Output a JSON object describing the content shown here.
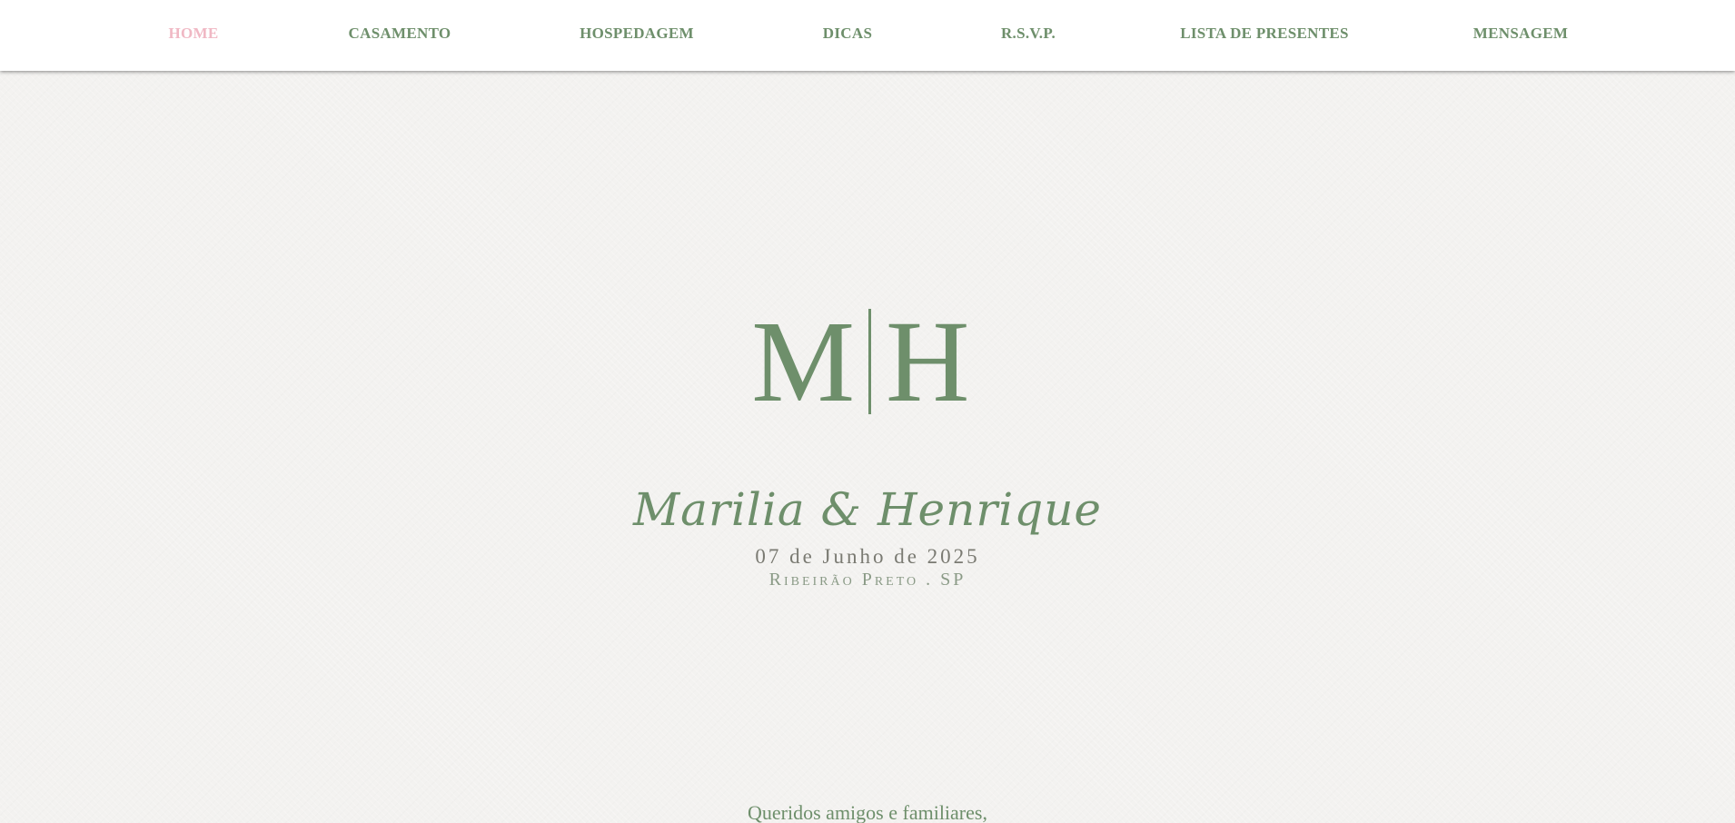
{
  "nav": {
    "items": [
      {
        "label": "HOME",
        "active": true
      },
      {
        "label": "CASAMENTO"
      },
      {
        "label": "HOSPEDAGEM"
      },
      {
        "label": "DICAS"
      },
      {
        "label": "R.S.V.P."
      },
      {
        "label": "LISTA DE PRESENTES"
      },
      {
        "label": "MENSAGEM"
      }
    ]
  },
  "hero": {
    "monogram_left": "M",
    "monogram_right": "H",
    "names": "Marilia & Henrique",
    "date": "07 de Junho de 2025",
    "location": "Ribeirão Preto . SP"
  },
  "message": {
    "greeting": "Queridos amigos e familiares,"
  },
  "colors": {
    "accent_green": "#6e8f6b",
    "active_pink": "#f0b8c4",
    "background": "#f3f2f0"
  }
}
